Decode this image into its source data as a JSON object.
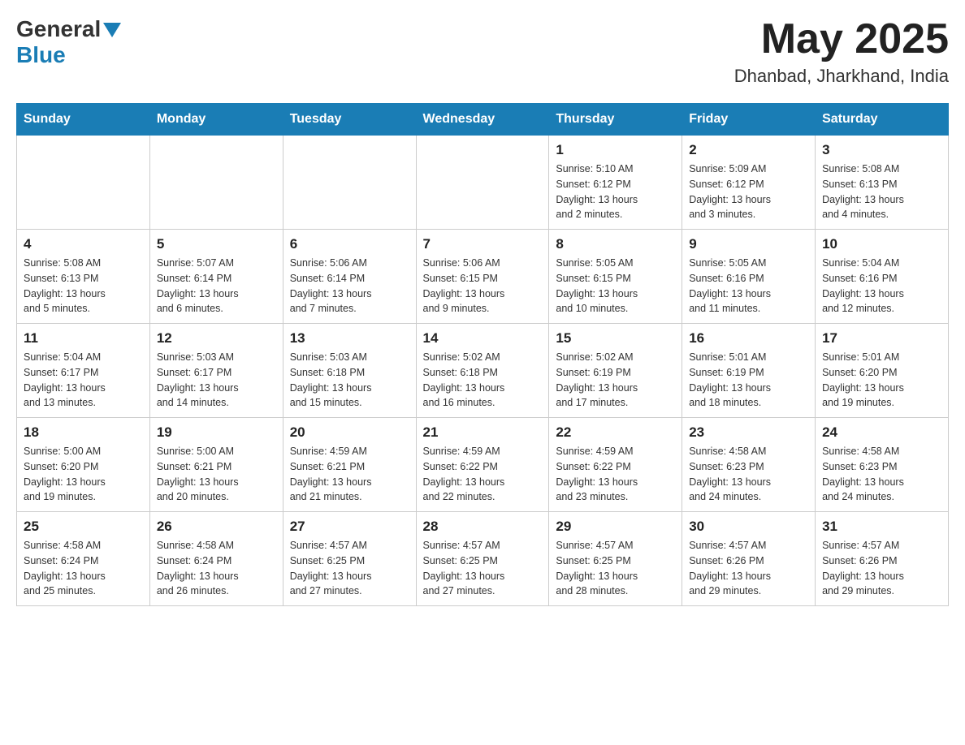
{
  "header": {
    "logo_general": "General",
    "logo_blue": "Blue",
    "month_title": "May 2025",
    "location": "Dhanbad, Jharkhand, India"
  },
  "weekdays": [
    "Sunday",
    "Monday",
    "Tuesday",
    "Wednesday",
    "Thursday",
    "Friday",
    "Saturday"
  ],
  "weeks": [
    [
      {
        "day": "",
        "info": ""
      },
      {
        "day": "",
        "info": ""
      },
      {
        "day": "",
        "info": ""
      },
      {
        "day": "",
        "info": ""
      },
      {
        "day": "1",
        "info": "Sunrise: 5:10 AM\nSunset: 6:12 PM\nDaylight: 13 hours\nand 2 minutes."
      },
      {
        "day": "2",
        "info": "Sunrise: 5:09 AM\nSunset: 6:12 PM\nDaylight: 13 hours\nand 3 minutes."
      },
      {
        "day": "3",
        "info": "Sunrise: 5:08 AM\nSunset: 6:13 PM\nDaylight: 13 hours\nand 4 minutes."
      }
    ],
    [
      {
        "day": "4",
        "info": "Sunrise: 5:08 AM\nSunset: 6:13 PM\nDaylight: 13 hours\nand 5 minutes."
      },
      {
        "day": "5",
        "info": "Sunrise: 5:07 AM\nSunset: 6:14 PM\nDaylight: 13 hours\nand 6 minutes."
      },
      {
        "day": "6",
        "info": "Sunrise: 5:06 AM\nSunset: 6:14 PM\nDaylight: 13 hours\nand 7 minutes."
      },
      {
        "day": "7",
        "info": "Sunrise: 5:06 AM\nSunset: 6:15 PM\nDaylight: 13 hours\nand 9 minutes."
      },
      {
        "day": "8",
        "info": "Sunrise: 5:05 AM\nSunset: 6:15 PM\nDaylight: 13 hours\nand 10 minutes."
      },
      {
        "day": "9",
        "info": "Sunrise: 5:05 AM\nSunset: 6:16 PM\nDaylight: 13 hours\nand 11 minutes."
      },
      {
        "day": "10",
        "info": "Sunrise: 5:04 AM\nSunset: 6:16 PM\nDaylight: 13 hours\nand 12 minutes."
      }
    ],
    [
      {
        "day": "11",
        "info": "Sunrise: 5:04 AM\nSunset: 6:17 PM\nDaylight: 13 hours\nand 13 minutes."
      },
      {
        "day": "12",
        "info": "Sunrise: 5:03 AM\nSunset: 6:17 PM\nDaylight: 13 hours\nand 14 minutes."
      },
      {
        "day": "13",
        "info": "Sunrise: 5:03 AM\nSunset: 6:18 PM\nDaylight: 13 hours\nand 15 minutes."
      },
      {
        "day": "14",
        "info": "Sunrise: 5:02 AM\nSunset: 6:18 PM\nDaylight: 13 hours\nand 16 minutes."
      },
      {
        "day": "15",
        "info": "Sunrise: 5:02 AM\nSunset: 6:19 PM\nDaylight: 13 hours\nand 17 minutes."
      },
      {
        "day": "16",
        "info": "Sunrise: 5:01 AM\nSunset: 6:19 PM\nDaylight: 13 hours\nand 18 minutes."
      },
      {
        "day": "17",
        "info": "Sunrise: 5:01 AM\nSunset: 6:20 PM\nDaylight: 13 hours\nand 19 minutes."
      }
    ],
    [
      {
        "day": "18",
        "info": "Sunrise: 5:00 AM\nSunset: 6:20 PM\nDaylight: 13 hours\nand 19 minutes."
      },
      {
        "day": "19",
        "info": "Sunrise: 5:00 AM\nSunset: 6:21 PM\nDaylight: 13 hours\nand 20 minutes."
      },
      {
        "day": "20",
        "info": "Sunrise: 4:59 AM\nSunset: 6:21 PM\nDaylight: 13 hours\nand 21 minutes."
      },
      {
        "day": "21",
        "info": "Sunrise: 4:59 AM\nSunset: 6:22 PM\nDaylight: 13 hours\nand 22 minutes."
      },
      {
        "day": "22",
        "info": "Sunrise: 4:59 AM\nSunset: 6:22 PM\nDaylight: 13 hours\nand 23 minutes."
      },
      {
        "day": "23",
        "info": "Sunrise: 4:58 AM\nSunset: 6:23 PM\nDaylight: 13 hours\nand 24 minutes."
      },
      {
        "day": "24",
        "info": "Sunrise: 4:58 AM\nSunset: 6:23 PM\nDaylight: 13 hours\nand 24 minutes."
      }
    ],
    [
      {
        "day": "25",
        "info": "Sunrise: 4:58 AM\nSunset: 6:24 PM\nDaylight: 13 hours\nand 25 minutes."
      },
      {
        "day": "26",
        "info": "Sunrise: 4:58 AM\nSunset: 6:24 PM\nDaylight: 13 hours\nand 26 minutes."
      },
      {
        "day": "27",
        "info": "Sunrise: 4:57 AM\nSunset: 6:25 PM\nDaylight: 13 hours\nand 27 minutes."
      },
      {
        "day": "28",
        "info": "Sunrise: 4:57 AM\nSunset: 6:25 PM\nDaylight: 13 hours\nand 27 minutes."
      },
      {
        "day": "29",
        "info": "Sunrise: 4:57 AM\nSunset: 6:25 PM\nDaylight: 13 hours\nand 28 minutes."
      },
      {
        "day": "30",
        "info": "Sunrise: 4:57 AM\nSunset: 6:26 PM\nDaylight: 13 hours\nand 29 minutes."
      },
      {
        "day": "31",
        "info": "Sunrise: 4:57 AM\nSunset: 6:26 PM\nDaylight: 13 hours\nand 29 minutes."
      }
    ]
  ]
}
